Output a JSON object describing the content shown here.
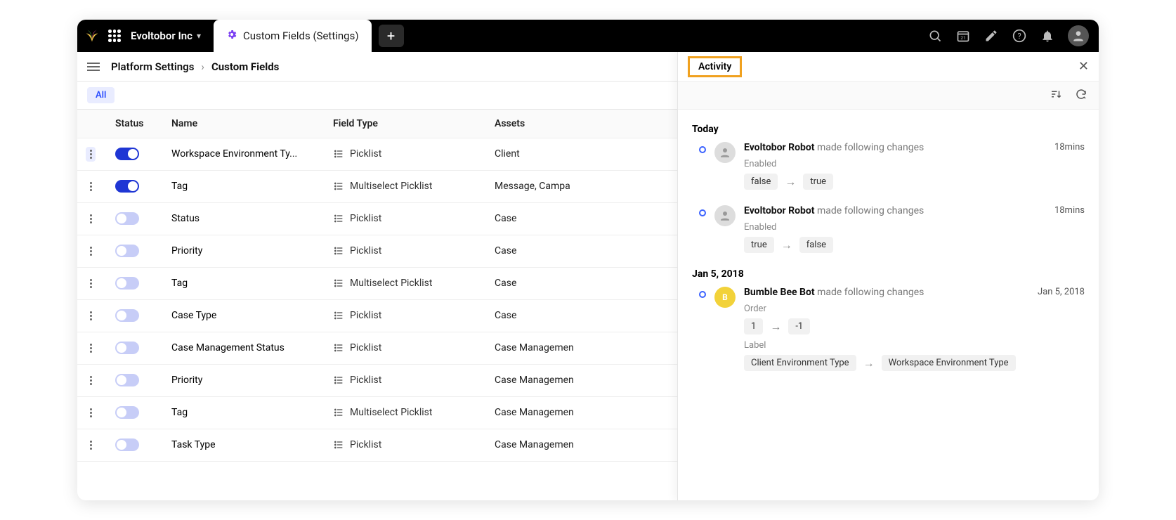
{
  "header": {
    "org": "Evoltobor Inc",
    "tab_label": "Custom Fields (Settings)"
  },
  "breadcrumbs": {
    "root": "Platform Settings",
    "current": "Custom Fields"
  },
  "filter": {
    "chip": "All"
  },
  "columns": {
    "status": "Status",
    "name": "Name",
    "type": "Field Type",
    "assets": "Assets"
  },
  "rows": [
    {
      "on": true,
      "strong": true,
      "name": "Workspace Environment Ty...",
      "type": "Picklist",
      "assets": "Client"
    },
    {
      "on": true,
      "strong": true,
      "name": "Tag",
      "type": "Multiselect Picklist",
      "assets": "Message, Campa"
    },
    {
      "on": true,
      "strong": false,
      "name": "Status",
      "type": "Picklist",
      "assets": "Case"
    },
    {
      "on": true,
      "strong": false,
      "name": "Priority",
      "type": "Picklist",
      "assets": "Case"
    },
    {
      "on": true,
      "strong": false,
      "name": "Tag",
      "type": "Multiselect Picklist",
      "assets": "Case"
    },
    {
      "on": true,
      "strong": false,
      "name": "Case Type",
      "type": "Picklist",
      "assets": "Case"
    },
    {
      "on": true,
      "strong": false,
      "name": "Case Management Status",
      "type": "Picklist",
      "assets": "Case Managemen"
    },
    {
      "on": true,
      "strong": false,
      "name": "Priority",
      "type": "Picklist",
      "assets": "Case Managemen"
    },
    {
      "on": true,
      "strong": false,
      "name": "Tag",
      "type": "Multiselect Picklist",
      "assets": "Case Managemen"
    },
    {
      "on": true,
      "strong": false,
      "name": "Task Type",
      "type": "Picklist",
      "assets": "Case Managemen"
    }
  ],
  "activity": {
    "title": "Activity",
    "groups": [
      {
        "label": "Today",
        "entries": [
          {
            "actor": "Evoltobor Robot",
            "action": "made following changes",
            "time": "18mins",
            "avatar": "grey",
            "changes": [
              {
                "field": "Enabled",
                "from": "false",
                "to": "true"
              }
            ]
          },
          {
            "actor": "Evoltobor Robot",
            "action": "made following changes",
            "time": "18mins",
            "avatar": "grey",
            "changes": [
              {
                "field": "Enabled",
                "from": "true",
                "to": "false"
              }
            ]
          }
        ]
      },
      {
        "label": "Jan 5, 2018",
        "entries": [
          {
            "actor": "Bumble Bee Bot",
            "action": "made following changes",
            "time": "Jan 5, 2018",
            "avatar": "yellow",
            "avatar_initial": "B",
            "changes": [
              {
                "field": "Order",
                "from": "1",
                "to": "-1"
              },
              {
                "field": "Label",
                "from": "Client Environment Type",
                "to": "Workspace Environment Type"
              }
            ]
          }
        ]
      }
    ]
  }
}
